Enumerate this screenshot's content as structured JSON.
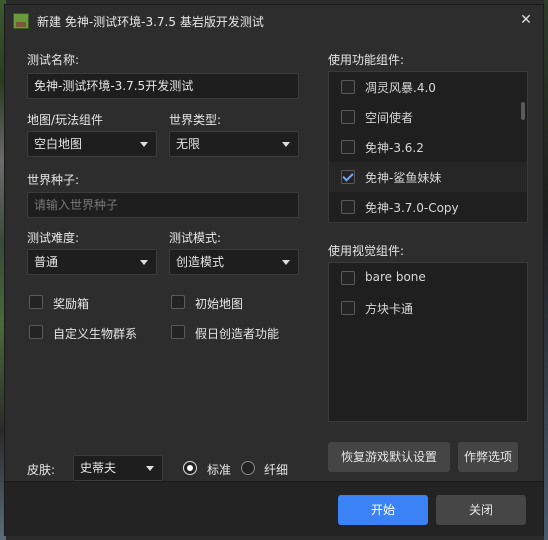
{
  "window": {
    "title": "新建 免神-测试环境-3.7.5 基岩版开发测试"
  },
  "form": {
    "test_name_label": "测试名称:",
    "test_name_value": "免神-测试环境-3.7.5开发测试",
    "map_label": "地图/玩法组件",
    "map_value": "空白地图",
    "world_type_label": "世界类型:",
    "world_type_value": "无限",
    "seed_label": "世界种子:",
    "seed_placeholder": "请输入世界种子",
    "difficulty_label": "测试难度:",
    "difficulty_value": "普通",
    "mode_label": "测试模式:",
    "mode_value": "创造模式",
    "checkboxes": [
      {
        "label": "奖励箱",
        "checked": false
      },
      {
        "label": "初始地图",
        "checked": false
      },
      {
        "label": "自定义生物群系",
        "checked": false
      },
      {
        "label": "假日创造者功能",
        "checked": false
      }
    ],
    "skin_label": "皮肤:",
    "skin_value": "史蒂夫",
    "skin_radio_standard": "标准",
    "skin_radio_slim": "纤细",
    "skin_selected": "标准"
  },
  "function_components": {
    "label": "使用功能组件:",
    "items": [
      {
        "label": "凋灵风暴.4.0",
        "checked": false
      },
      {
        "label": "空间使者",
        "checked": false
      },
      {
        "label": "免神-3.6.2",
        "checked": false
      },
      {
        "label": "免神-鲨鱼妹妹",
        "checked": true
      },
      {
        "label": "免神-3.7.0-Copy",
        "checked": false
      }
    ]
  },
  "visual_components": {
    "label": "使用视觉组件:",
    "items": [
      {
        "label": "bare bone",
        "checked": false
      },
      {
        "label": "方块卡通",
        "checked": false
      }
    ]
  },
  "buttons": {
    "restore_defaults": "恢复游戏默认设置",
    "cheats": "作弊选项",
    "start": "开始",
    "close": "关闭"
  },
  "colors": {
    "primary": "#3b82f6",
    "background": "#2d2d2d",
    "input_bg": "#1e1e1e"
  }
}
